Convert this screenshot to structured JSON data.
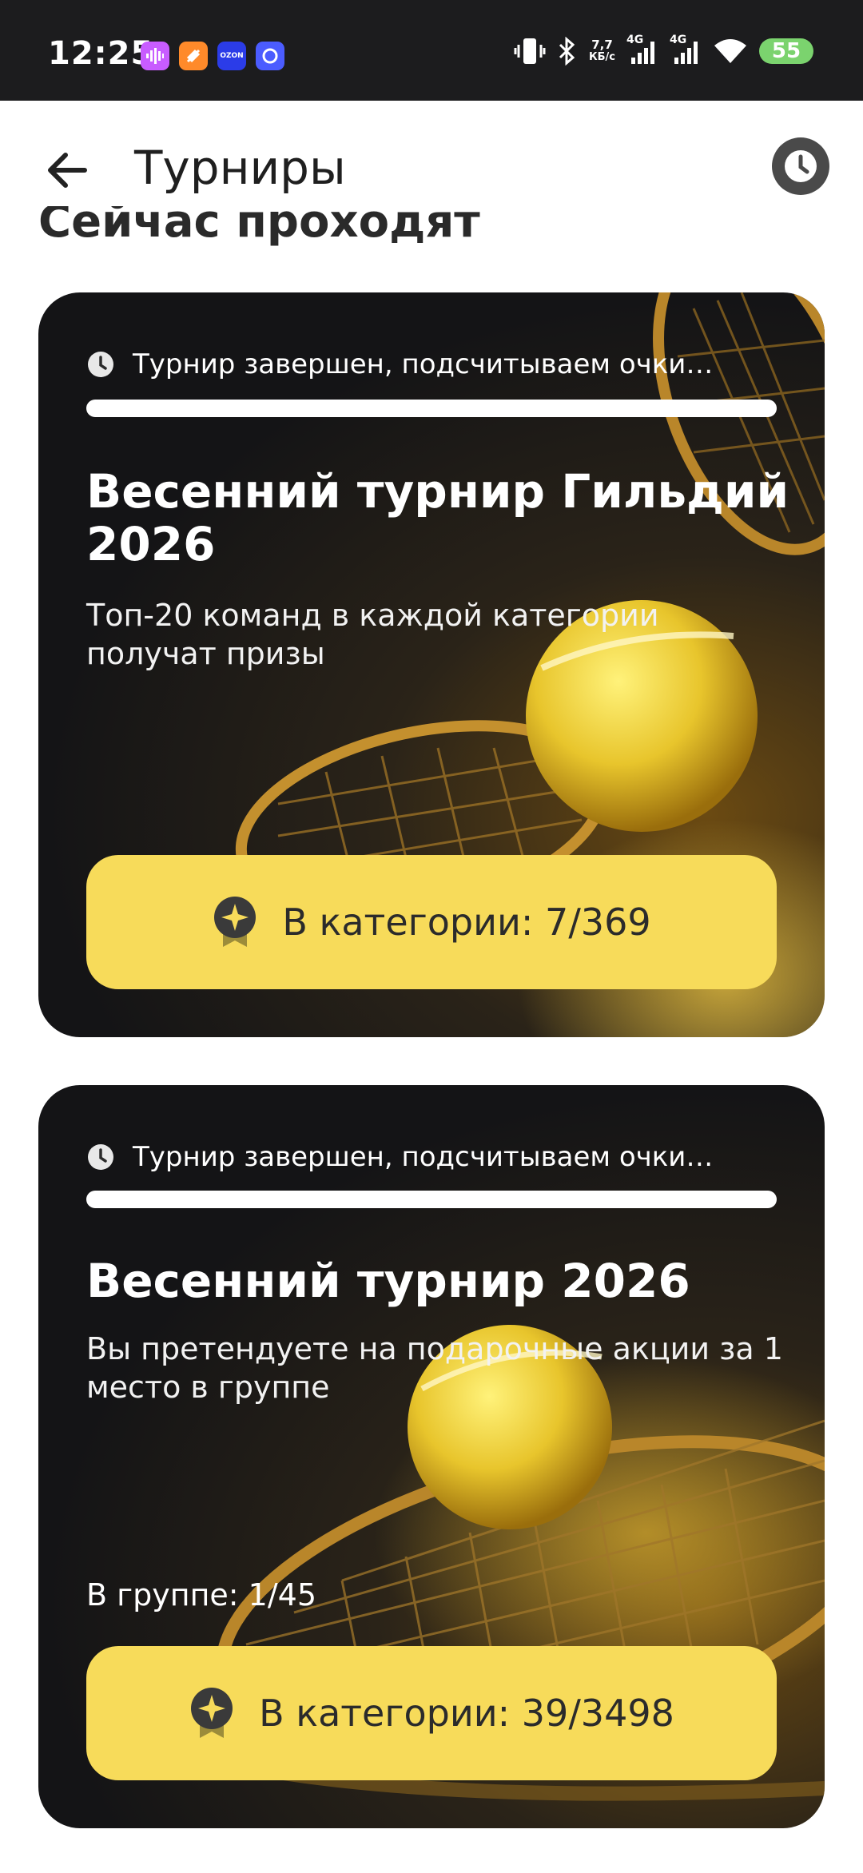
{
  "status_bar": {
    "time": "12:25",
    "apps": [
      {
        "icon": "sound-app-icon",
        "color": "#c85cff"
      },
      {
        "icon": "orange-app-icon",
        "color": "#ff8a2a"
      },
      {
        "icon": "ozon-icon",
        "color": "#2b3ce8",
        "label": "OZON"
      },
      {
        "icon": "blue-app-icon",
        "color": "#4b5cff"
      }
    ],
    "speed_value": "7,7",
    "speed_unit": "КБ/с",
    "network1": "4G",
    "network2": "4G",
    "battery": "55"
  },
  "header": {
    "title": "Турниры",
    "back_icon": "arrow-left-icon",
    "history_icon": "clock-icon"
  },
  "section_title": "Сейчас проходят",
  "tournaments": [
    {
      "status": "Турнир завершен, подсчитываем очки…",
      "progress": 1.0,
      "title_line1": "Весенний турнир Гильдий",
      "title_line2": "2026",
      "description_line1": "Топ-20 команд в каждой категории",
      "description_line2": "получат призы",
      "group": "",
      "category_button": "В категории: 7/369"
    },
    {
      "status": "Турнир завершен, подсчитываем очки…",
      "progress": 1.0,
      "title_line1": "Весенний турнир 2026",
      "title_line2": "",
      "description_line1": "Вы претендуете на подарочные акции за 1",
      "description_line2": "место в группе",
      "group": "В группе: 1/45",
      "category_button": "В категории: 39/3498"
    }
  ],
  "colors": {
    "accent_button": "#f7db5a",
    "card_bg": "#141416",
    "battery": "#7bd36e"
  }
}
